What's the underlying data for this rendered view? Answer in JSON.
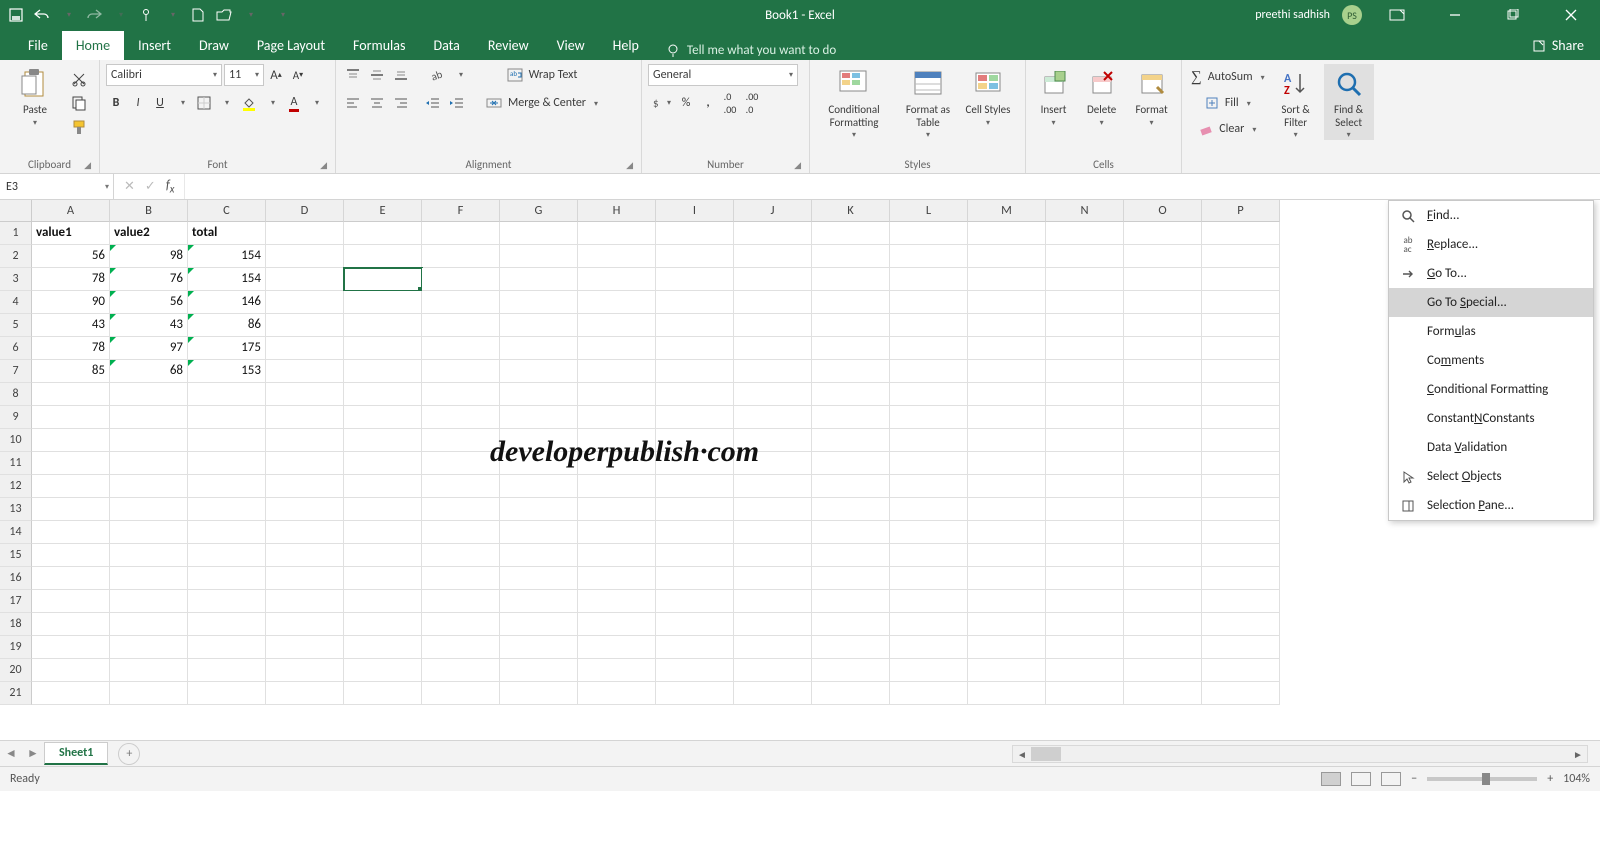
{
  "title": "Book1  -  Excel",
  "user": {
    "name": "preethi sadhish",
    "initials": "PS"
  },
  "tabs": [
    "File",
    "Home",
    "Insert",
    "Draw",
    "Page Layout",
    "Formulas",
    "Data",
    "Review",
    "View",
    "Help"
  ],
  "active_tab": "Home",
  "tellme": "Tell me what you want to do",
  "share": "Share",
  "ribbon": {
    "clipboard": {
      "paste": "Paste",
      "label": "Clipboard"
    },
    "font": {
      "name": "Calibri",
      "size": "11",
      "label": "Font"
    },
    "alignment": {
      "wrap": "Wrap Text",
      "merge": "Merge & Center",
      "label": "Alignment"
    },
    "number": {
      "format": "General",
      "label": "Number"
    },
    "styles": {
      "cond": "Conditional Formatting",
      "fat": "Format as Table",
      "cstyle": "Cell Styles",
      "label": "Styles"
    },
    "cells": {
      "insert": "Insert",
      "delete": "Delete",
      "format": "Format",
      "label": "Cells"
    },
    "editing": {
      "autosum": "AutoSum",
      "fill": "Fill",
      "clear": "Clear",
      "sort": "Sort & Filter",
      "find": "Find & Select",
      "label": ""
    }
  },
  "namebox": "E3",
  "columns": [
    "A",
    "B",
    "C",
    "D",
    "E",
    "F",
    "G",
    "H",
    "I",
    "J",
    "K",
    "L",
    "M",
    "N",
    "O",
    "P"
  ],
  "row_count": 21,
  "sheet_data": {
    "headers": [
      "value1",
      "value2",
      "total"
    ],
    "rows": [
      [
        56,
        98,
        154
      ],
      [
        78,
        76,
        154
      ],
      [
        90,
        56,
        146
      ],
      [
        43,
        43,
        86
      ],
      [
        78,
        97,
        175
      ],
      [
        85,
        68,
        153
      ]
    ]
  },
  "selected_cell": "E3",
  "menu": {
    "items": [
      {
        "label": "Find...",
        "icon": "search"
      },
      {
        "label": "Replace...",
        "icon": "replace"
      },
      {
        "label": "Go To...",
        "icon": "arrow"
      },
      {
        "label": "Go To Special...",
        "icon": "",
        "hl": true
      },
      {
        "label": "Formulas",
        "icon": ""
      },
      {
        "label": "Comments",
        "icon": ""
      },
      {
        "label": "Conditional Formatting",
        "icon": ""
      },
      {
        "label": "Constants",
        "icon": ""
      },
      {
        "label": "Data Validation",
        "icon": ""
      },
      {
        "label": "Select Objects",
        "icon": "cursor"
      },
      {
        "label": "Selection Pane...",
        "icon": "pane"
      }
    ]
  },
  "watermark": "developerpublish·com",
  "sheet_tab": "Sheet1",
  "status": "Ready",
  "zoom": "104%"
}
